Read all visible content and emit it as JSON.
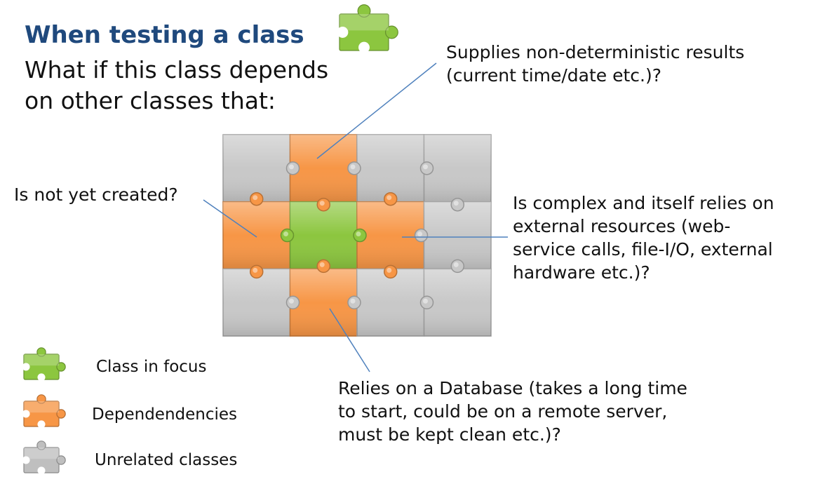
{
  "title": "When testing a class",
  "subtitle": [
    "What if this class depends",
    "on other classes that:"
  ],
  "callouts": {
    "nondeterministic": [
      "Supplies non-deterministic results",
      "(current time/date etc.)?"
    ],
    "not_created": [
      "Is not yet created?"
    ],
    "complex": [
      "Is complex and itself relies on",
      "external resources (web-",
      "service calls, file-I/O, external",
      "hardware etc.)?"
    ],
    "database": [
      "Relies on a Database (takes a long time",
      "to start, could be on a remote server,",
      "must be kept clean etc.)?"
    ]
  },
  "legend": [
    {
      "label": "Class in focus",
      "color": "#8cc63f"
    },
    {
      "label": "Dependendencies",
      "color": "#f79646"
    },
    {
      "label": "Unrelated classes",
      "color": "#bfbfbf"
    }
  ],
  "colors": {
    "focus": "#8cc63f",
    "dependency": "#f79646",
    "unrelated": "#c8c8c8",
    "line": "#4f81bd",
    "title": "#1f497d"
  },
  "puzzle": {
    "rows": 3,
    "cols": 4,
    "grid": [
      [
        "unrelated",
        "dependency",
        "unrelated",
        "unrelated"
      ],
      [
        "dependency",
        "focus",
        "dependency",
        "unrelated"
      ],
      [
        "unrelated",
        "dependency",
        "unrelated",
        "unrelated"
      ]
    ]
  }
}
